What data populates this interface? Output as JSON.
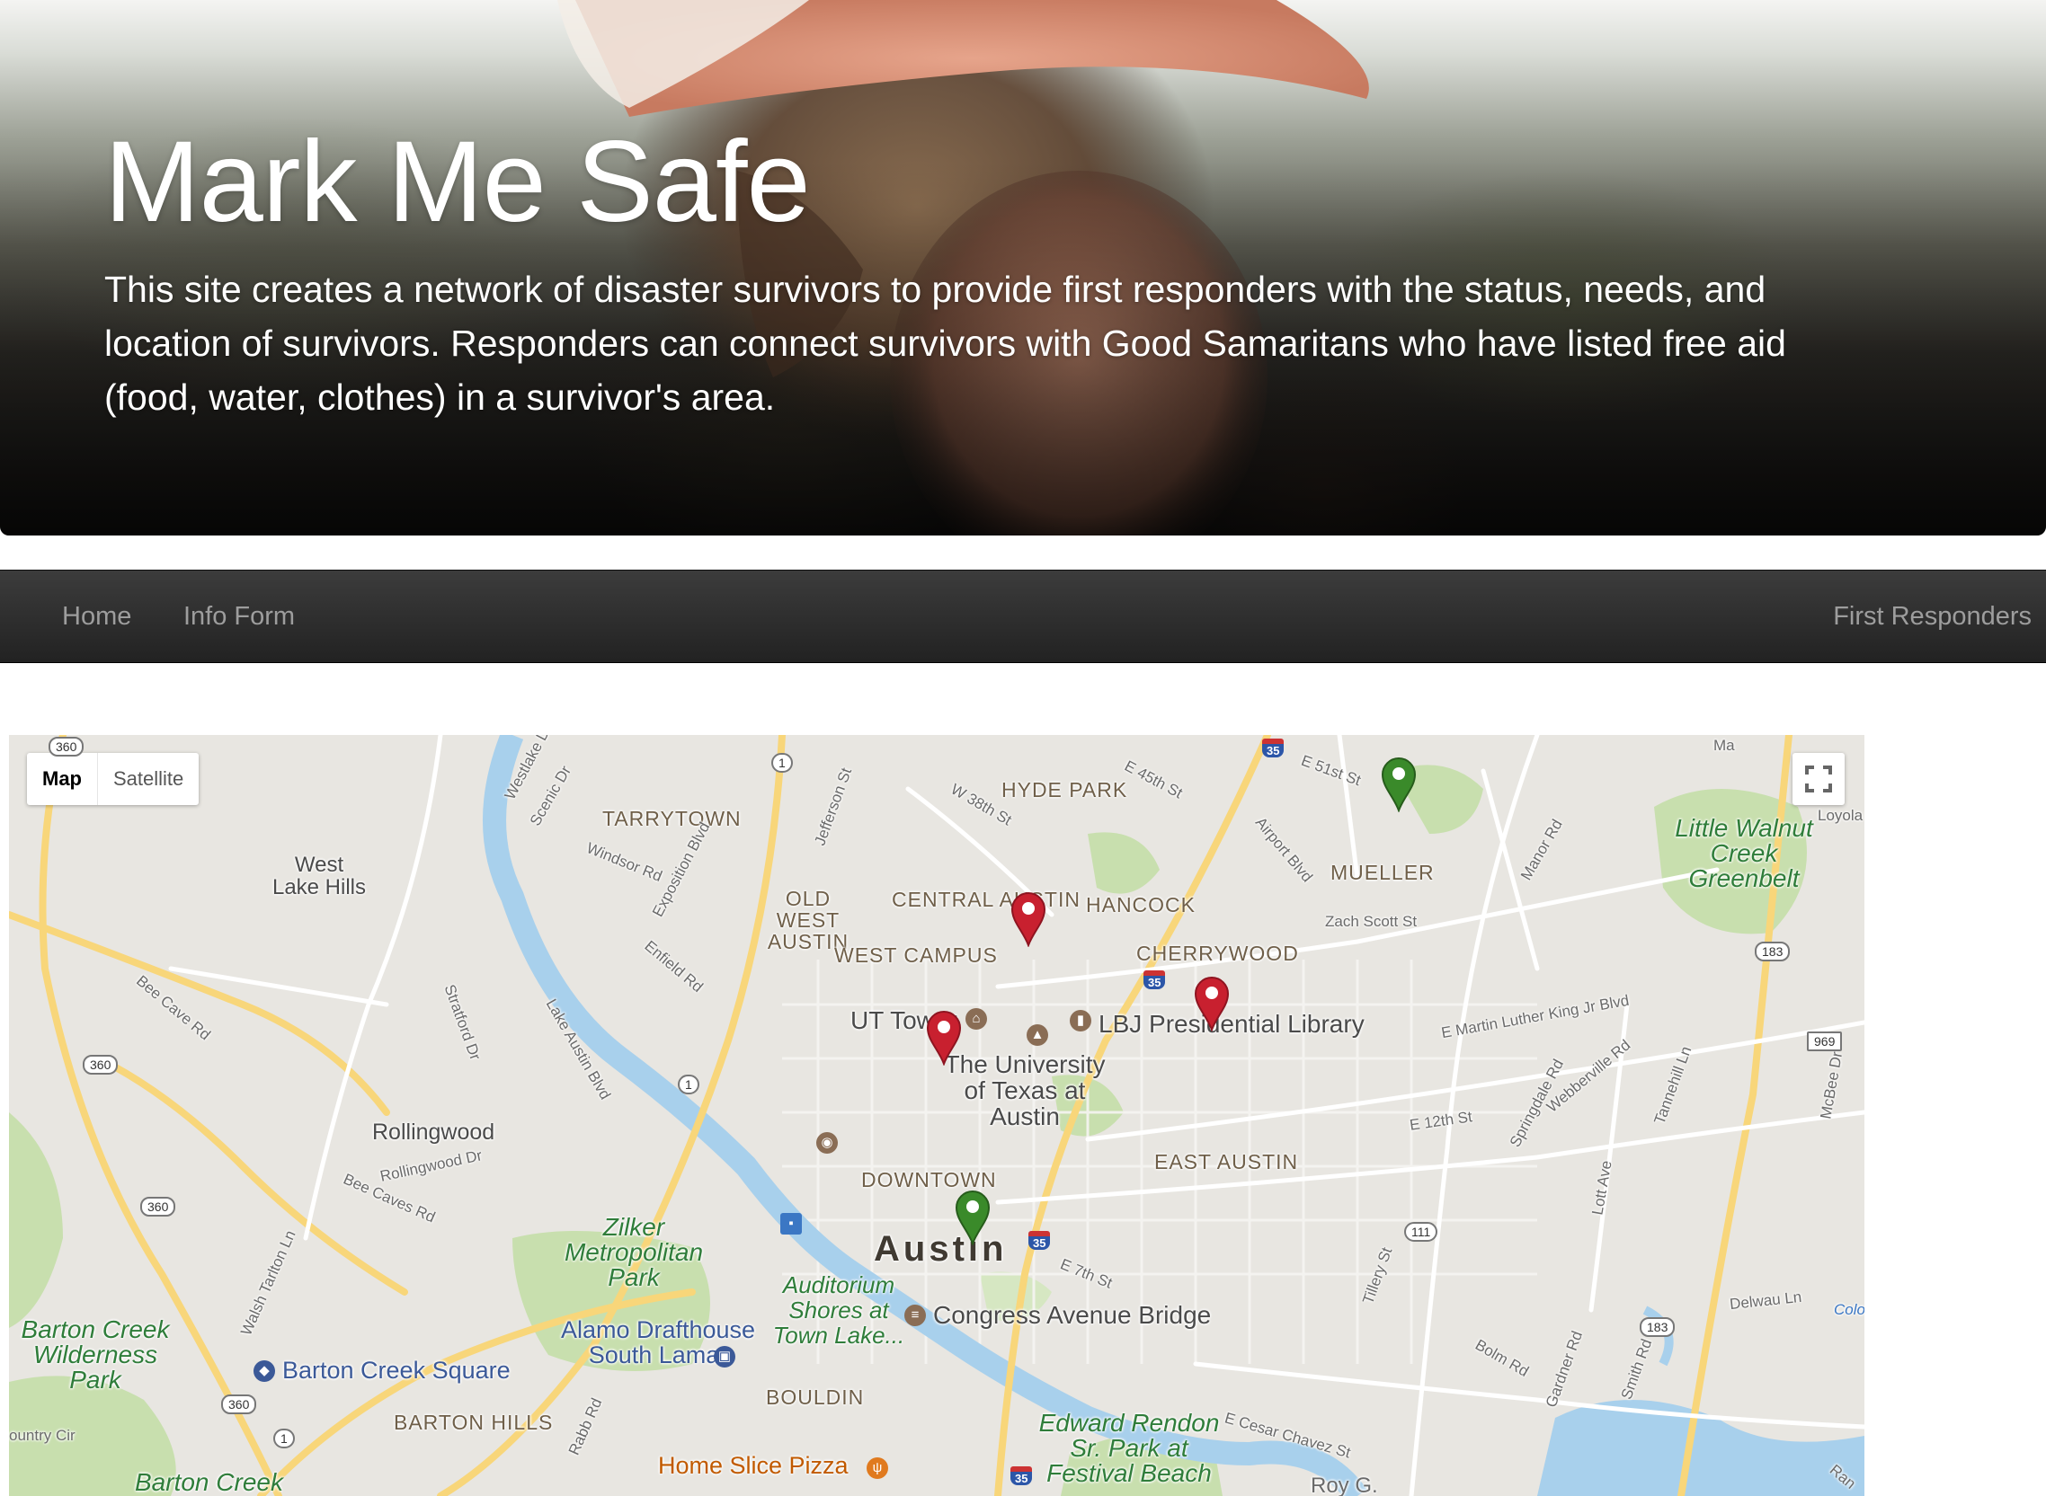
{
  "hero": {
    "title": "Mark Me Safe",
    "description": "This site creates a network of disaster survivors to provide first responders with the status, needs, and location of survivors. Responders can connect survivors with Good Samaritans who have listed free aid (food, water, clothes) in a survivor's area."
  },
  "nav": {
    "home": "Home",
    "info_form": "Info Form",
    "first_responders": "First Responders"
  },
  "map": {
    "type_options": [
      "Map",
      "Satellite"
    ],
    "selected_type": "Map",
    "neighborhoods": [
      "TARRYTOWN",
      "HYDE PARK",
      "OLD WEST AUSTIN",
      "CENTRAL AUSTIN",
      "HANCOCK",
      "MUELLER",
      "WEST CAMPUS",
      "CHERRYWOOD",
      "DOWNTOWN",
      "EAST AUSTIN",
      "BARTON HILLS",
      "BOULDIN"
    ],
    "places": [
      "West Lake Hills",
      "Rollingwood",
      "UT Tower",
      "LBJ Presidential Library",
      "The University of Texas at Austin",
      "Congress Avenue Bridge",
      "Alamo Drafthouse South Lamar",
      "Auditorium Shores at Town Lake...",
      "Barton Creek Square"
    ],
    "parks": [
      "Zilker Metropolitan Park",
      "Little Walnut Creek Greenbelt",
      "Barton Creek Wilderness Park",
      "Edward Rendon Sr. Park at Festival Beach",
      "Barton Creek"
    ],
    "city": "Austin",
    "food_place": "Home Slice Pizza",
    "streets": [
      "E 51st St",
      "E 45th St",
      "W 38th St",
      "Windsor Rd",
      "Exposition Blvd",
      "Enfield Rd",
      "Jefferson St",
      "Scenic Dr",
      "Westlake Dr",
      "Bee Cave Rd",
      "Stratford Dr",
      "Lake Austin Blvd",
      "Rollingwood Dr",
      "Bee Caves Rd",
      "Walsh Tarlton Ln",
      "Airport Blvd",
      "Zach Scott St",
      "Manor Rd",
      "E Martin Luther King Jr Blvd",
      "E 12th St",
      "Springdale Rd",
      "Webberville Rd",
      "Tannehill Ln",
      "McBee Dr",
      "E 7th St",
      "Tillery St",
      "Lott Ave",
      "Delwau Ln",
      "Bolm Rd",
      "Gardner Rd",
      "Smith Rd",
      "E Cesar Chavez St",
      "Rabb Rd",
      "Loyola",
      "Colo",
      "Ma",
      "Roy G.",
      "ountry Cir",
      "Ran"
    ],
    "highway_shields": [
      "360",
      "1",
      "35",
      "183",
      "969",
      "111"
    ],
    "markers": [
      {
        "status": "needs-help",
        "color": "#c8202f"
      },
      {
        "status": "needs-help",
        "color": "#c8202f"
      },
      {
        "status": "needs-help",
        "color": "#c8202f"
      },
      {
        "status": "safe",
        "color": "#3a8a2a"
      },
      {
        "status": "safe",
        "color": "#3a8a2a"
      }
    ]
  },
  "colors": {
    "navbar": "#222222",
    "nav_text": "#9d9d9d",
    "marker_red": "#c8202f",
    "marker_green": "#3a8a2a"
  }
}
